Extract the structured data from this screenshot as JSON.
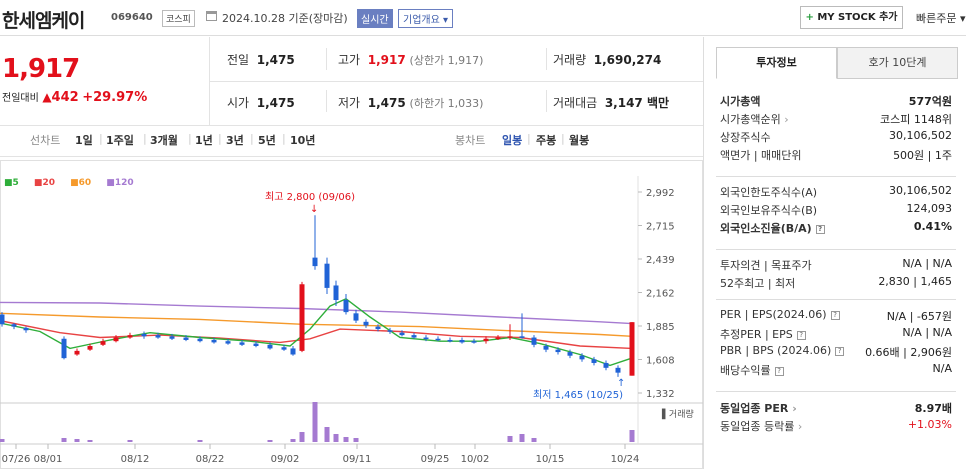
{
  "header": {
    "name": "한세엠케이",
    "code": "069640",
    "market": "코스피",
    "date": "2024.10.28 기준(장마감)",
    "realtime": "실시간",
    "overview": "기업개요",
    "mystock_label": "MY STOCK 추가",
    "quick_order": "빠른주문"
  },
  "quote": {
    "price": "1,917",
    "change_label": "전일대비",
    "change_amount": "442",
    "change_pct": "+29.97%",
    "prev_close_label": "전일",
    "prev_close": "1,475",
    "high_label": "고가",
    "high": "1,917",
    "high_note": "(상한가 1,917)",
    "volume_label": "거래량",
    "volume": "1,690,274",
    "open_label": "시가",
    "open": "1,475",
    "low_label": "저가",
    "low": "1,475",
    "low_note": "(하한가 1,033)",
    "amount_label": "거래대금",
    "amount": "3,147 백만"
  },
  "period_tabs": {
    "line_label": "선차트",
    "line_items": [
      "1일",
      "1주일",
      "3개월",
      "1년",
      "3년",
      "5년",
      "10년"
    ],
    "candle_label": "봉차트",
    "candle_items": [
      "일봉",
      "주봉",
      "월봉"
    ],
    "active": "일봉"
  },
  "chart_data": {
    "type": "candlestick",
    "legend": [
      {
        "name": "5",
        "color": "#2fae3a"
      },
      {
        "name": "20",
        "color": "#e84343"
      },
      {
        "name": "60",
        "color": "#f59a2c"
      },
      {
        "name": "120",
        "color": "#a57ad1"
      }
    ],
    "yticks": [
      "2,992",
      "2,715",
      "2,439",
      "2,162",
      "1,885",
      "1,608",
      "1,332"
    ],
    "ylim": [
      1332,
      2992
    ],
    "xticks": [
      "07/26",
      "08/01",
      "08/12",
      "08/22",
      "09/02",
      "09/11",
      "09/25",
      "10/02",
      "10/15",
      "10/24"
    ],
    "high_annotation": "최고 2,800 (09/06)",
    "low_annotation": "최저 1,465 (10/25)",
    "volume_label": "거래량",
    "up_color": "#e2101b",
    "down_color": "#2063d6",
    "volume_color": "#a57ad1"
  },
  "info": {
    "tab_active": "투자정보",
    "tab_other": "호가 10단계",
    "rows1": [
      {
        "k": "시가총액",
        "v": "577억원",
        "bold": true
      },
      {
        "k": "시가총액순위",
        "v": "코스피 1148위"
      },
      {
        "k": "상장주식수",
        "v": "30,106,502"
      },
      {
        "k": "액면가 | 매매단위",
        "v": "500원 | 1주"
      }
    ],
    "rows2": [
      {
        "k": "외국인한도주식수(A)",
        "v": "30,106,502"
      },
      {
        "k": "외국인보유주식수(B)",
        "v": "124,093"
      },
      {
        "k": "외국인소진율(B/A)",
        "v": "0.41%",
        "bold": true
      }
    ],
    "rows3": [
      {
        "k": "투자의견 | 목표주가",
        "v": "N/A | N/A"
      },
      {
        "k": "52주최고 | 최저",
        "v": "2,830 | 1,465"
      }
    ],
    "rows4": [
      {
        "k": "PER | EPS(2024.06)",
        "v": "N/A | -657원"
      },
      {
        "k": "추정PER | EPS",
        "v": "N/A | N/A"
      },
      {
        "k": "PBR | BPS (2024.06)",
        "v": "0.66배 | 2,906원"
      },
      {
        "k": "배당수익률",
        "v": "N/A"
      }
    ],
    "rows5": [
      {
        "k": "동일업종 PER",
        "v": "8.97배",
        "bold": true
      },
      {
        "k": "동일업종 등락률",
        "v": "+1.03%",
        "red": true
      }
    ]
  }
}
